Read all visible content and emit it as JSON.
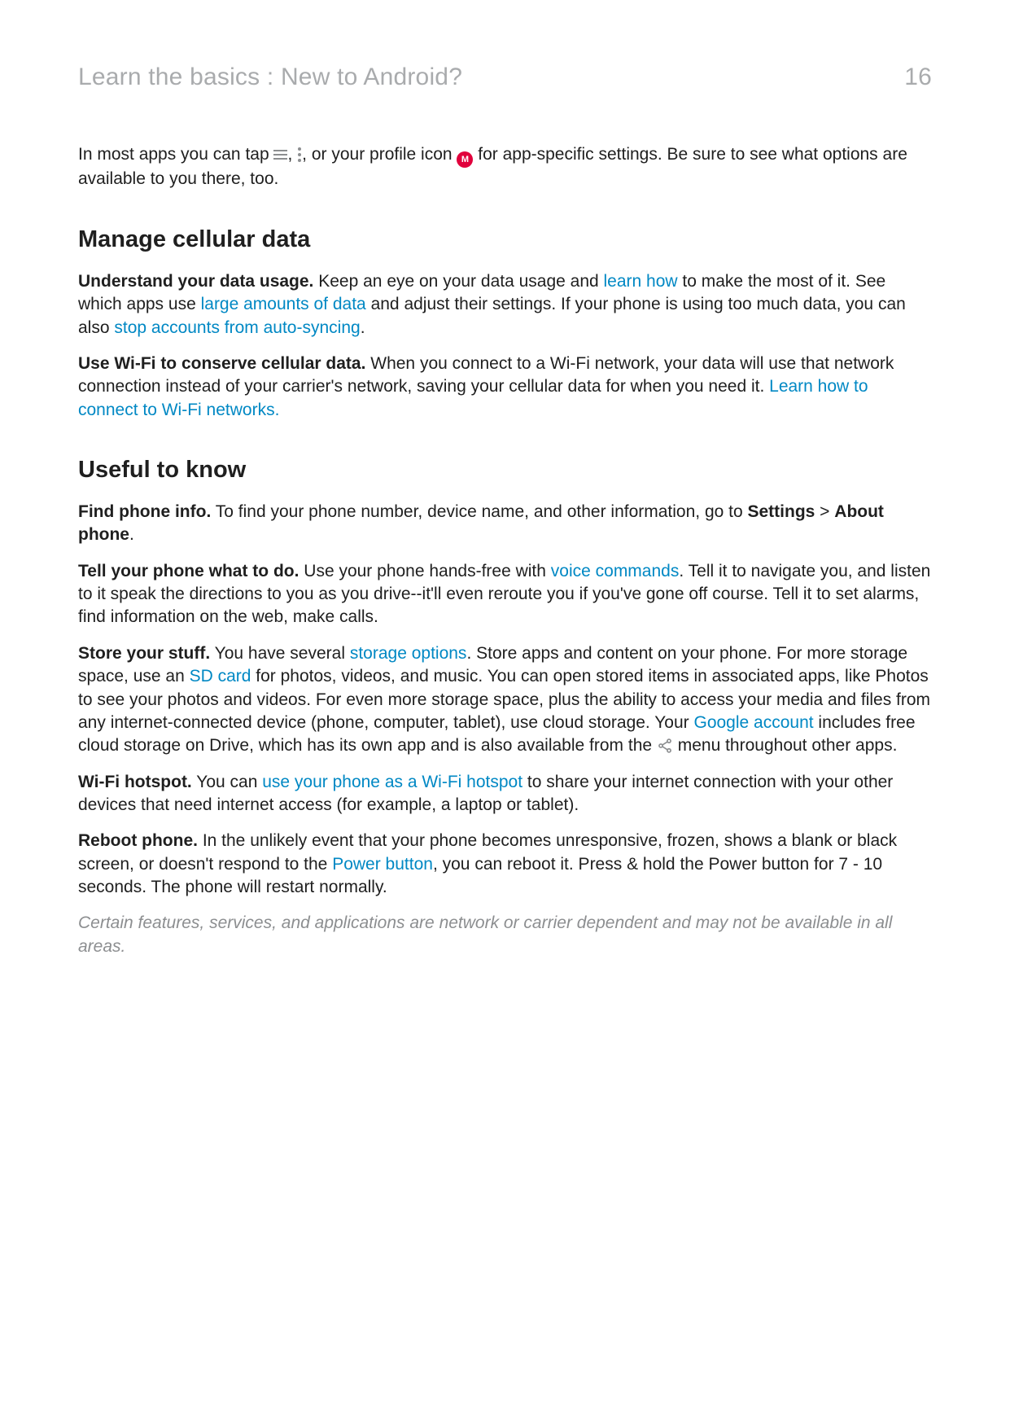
{
  "header": {
    "title": "Learn the basics : New to Android?",
    "page_number": "16"
  },
  "intro": {
    "before_icons": "In most apps you can tap ",
    "comma": ", ",
    "after_dots": ", or your profile icon ",
    "after_badge": " for app-specific settings. Be sure to see what options are available to you there, too.",
    "badge_letter": "M"
  },
  "section1": {
    "heading": "Manage cellular data",
    "p1": {
      "lead": "Understand your data usage.",
      "a": " Keep an eye on your data usage and ",
      "link_learn_how": "learn how",
      "b": " to make the most of it. See which apps use ",
      "link_large_amounts": "large amounts of data",
      "c": " and adjust their settings. If your phone is using too much data, you can also ",
      "link_stop_sync": "stop accounts from auto-syncing",
      "d": "."
    },
    "p2": {
      "lead": "Use Wi-Fi to conserve cellular data.",
      "a": " When you connect to a Wi-Fi network, your data will use that network connection instead of your carrier's network, saving your cellular data for when you need it. ",
      "link_wifi": "Learn how to connect to Wi-Fi networks."
    }
  },
  "section2": {
    "heading": "Useful to know",
    "p1": {
      "lead": "Find phone info.",
      "a": " To find your phone number, device name, and other information, go to ",
      "settings": "Settings",
      "gt": " > ",
      "about_phone": "About phone",
      "b": "."
    },
    "p2": {
      "lead": "Tell your phone what to do.",
      "a": " Use your phone hands-free with ",
      "link_voice": "voice commands",
      "b": ". Tell it to navigate you, and listen to it speak the directions to you as you drive--it'll even reroute you if you've gone off course. Tell it to set alarms, find information on the web, make calls."
    },
    "p3": {
      "lead": "Store your stuff.",
      "a": " You have several ",
      "link_storage": "storage options",
      "b": ". Store apps and content on your phone. For more storage space, use an ",
      "link_sd": "SD card",
      "c": " for photos, videos, and music. You can open stored items in associated apps, like Photos to see your photos and videos. For even more storage space, plus the ability to access your media and files from any internet-connected device (phone, computer, tablet), use cloud storage. Your ",
      "link_google": "Google account",
      "d": " includes free cloud storage on Drive, which has its own app and is also available from the ",
      "e": " menu throughout other apps."
    },
    "p4": {
      "lead": "Wi-Fi hotspot.",
      "a": " You can ",
      "link_hotspot": "use your phone as a Wi-Fi hotspot",
      "b": " to share your internet connection with your other devices that need internet access (for example, a laptop or tablet)."
    },
    "p5": {
      "lead": "Reboot phone.",
      "a": " In the unlikely event that your phone becomes unresponsive, frozen, shows a blank or black screen, or doesn't respond to the ",
      "link_power": "Power button",
      "b": ", you can reboot it. Press & hold the Power button for 7 - 10 seconds. The phone will restart normally."
    },
    "note": "Certain features, services, and applications are network or carrier dependent and may not be available in all areas."
  }
}
